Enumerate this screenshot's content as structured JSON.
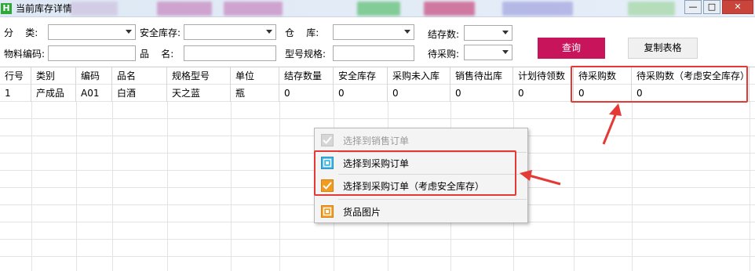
{
  "window": {
    "title": "当前库存详情",
    "icon_letter": "H"
  },
  "filters": {
    "category_label": "分    类:",
    "safety_stock_label": "安全库存:",
    "warehouse_label": "仓    库:",
    "stock_count_label": "结存数:",
    "material_code_label": "物料编码:",
    "product_name_label": "品    名:",
    "model_spec_label": "型号规格:",
    "to_purchase_label": "待采购:"
  },
  "buttons": {
    "query": "查询",
    "copy_table": "复制表格"
  },
  "table": {
    "headers": [
      "行号",
      "类别",
      "编码",
      "品名",
      "规格型号",
      "单位",
      "结存数量",
      "安全库存",
      "采购未入库",
      "销售待出库",
      "计划待领数",
      "待采购数",
      "待采购数（考虑安全库存）"
    ],
    "rows": [
      [
        "1",
        "产成品",
        "A01",
        "白酒",
        "天之蓝",
        "瓶",
        "0",
        "0",
        "0",
        "0",
        "0",
        "0",
        "0"
      ]
    ]
  },
  "context_menu": {
    "items": [
      {
        "label": "选择到销售订单",
        "enabled": false,
        "icon": "checkbox-check-icon"
      },
      {
        "label": "选择到采购订单",
        "enabled": true,
        "icon": "target-square-icon"
      },
      {
        "label": "选择到采购订单（考虑安全库存）",
        "enabled": true,
        "icon": "orange-check-icon"
      },
      {
        "label": "货品图片",
        "enabled": true,
        "icon": "image-square-icon"
      }
    ]
  },
  "colors": {
    "accent": "#c8145b",
    "highlight": "#e53935"
  }
}
